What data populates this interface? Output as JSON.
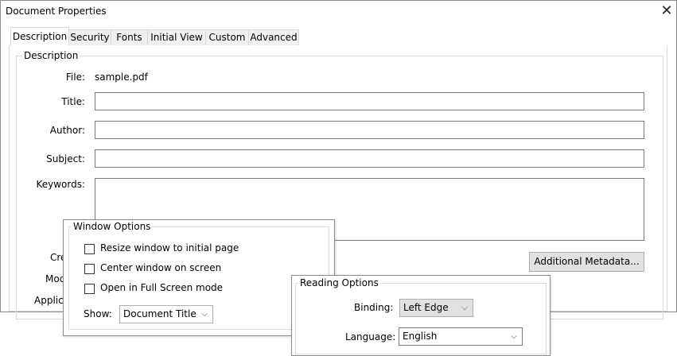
{
  "window": {
    "title": "Document Properties",
    "close_glyph": "✕"
  },
  "tabs": [
    {
      "label": "Description",
      "active": true
    },
    {
      "label": "Security",
      "active": false
    },
    {
      "label": "Fonts",
      "active": false
    },
    {
      "label": "Initial View",
      "active": false
    },
    {
      "label": "Custom",
      "active": false
    },
    {
      "label": "Advanced",
      "active": false
    }
  ],
  "description": {
    "group_label": "Description",
    "file_label": "File:",
    "file_value": "sample.pdf",
    "title_label": "Title:",
    "title_value": "",
    "author_label": "Author:",
    "author_value": "",
    "subject_label": "Subject:",
    "subject_value": "",
    "keywords_label": "Keywords:",
    "keywords_value": "",
    "created_label_partial": "Cre",
    "modified_label_partial": "Mod",
    "application_label_partial": "Applica",
    "additional_metadata_button": "Additional Metadata..."
  },
  "window_options": {
    "group_label": "Window Options",
    "options": [
      {
        "label": "Resize window to initial page",
        "checked": false
      },
      {
        "label": "Center window on screen",
        "checked": false
      },
      {
        "label": "Open in Full Screen mode",
        "checked": false
      }
    ],
    "show_label": "Show:",
    "show_value": "Document Title"
  },
  "reading_options": {
    "group_label": "Reading Options",
    "binding_label": "Binding:",
    "binding_value": "Left Edge",
    "language_label": "Language:",
    "language_value": "English"
  },
  "icons": {
    "close": "close-icon",
    "dropdown": "chevron-down-icon"
  }
}
